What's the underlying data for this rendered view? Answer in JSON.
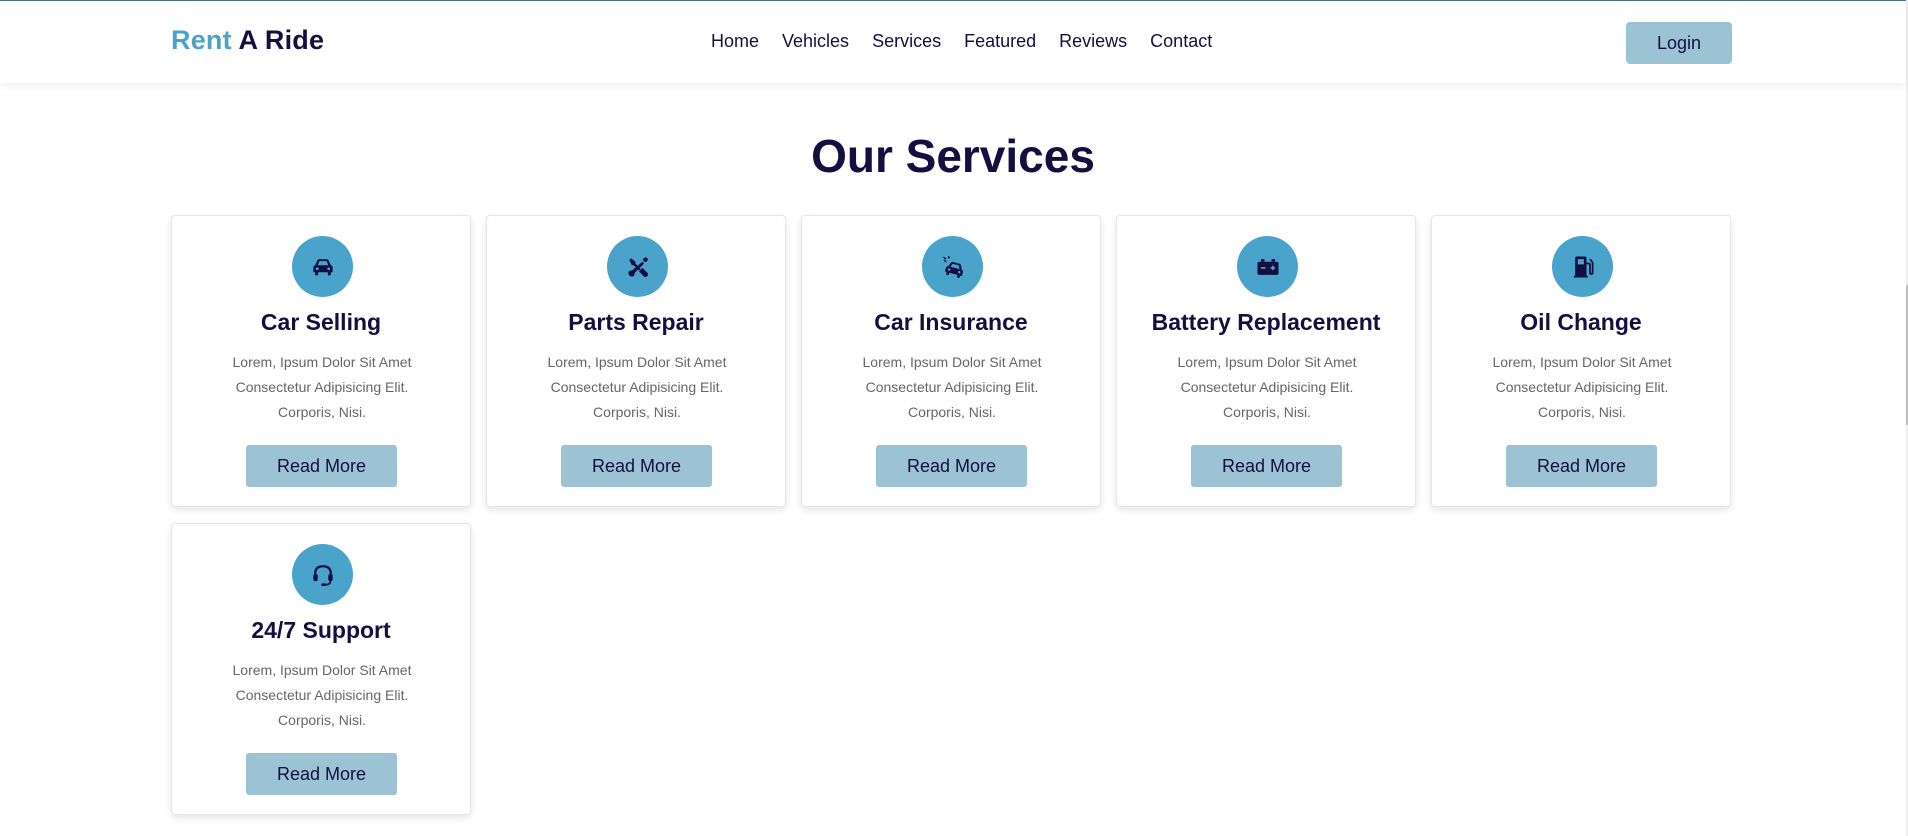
{
  "header": {
    "logo_accent": "Rent",
    "logo_rest": " A Ride",
    "nav": [
      "Home",
      "Vehicles",
      "Services",
      "Featured",
      "Reviews",
      "Contact"
    ],
    "login_label": "Login"
  },
  "section": {
    "title_plain": "Our ",
    "title_underlined": "Services"
  },
  "services": [
    {
      "title": "Car Selling",
      "icon": "car-icon",
      "desc": "Lorem, Ipsum Dolor Sit Amet Consectetur Adipisicing Elit. Corporis, Nisi.",
      "button": "Read More"
    },
    {
      "title": "Parts Repair",
      "icon": "tools-icon",
      "desc": "Lorem, Ipsum Dolor Sit Amet Consectetur Adipisicing Elit. Corporis, Nisi.",
      "button": "Read More"
    },
    {
      "title": "Car Insurance",
      "icon": "car-crash-icon",
      "desc": "Lorem, Ipsum Dolor Sit Amet Consectetur Adipisicing Elit. Corporis, Nisi.",
      "button": "Read More"
    },
    {
      "title": "Battery Replacement",
      "icon": "car-battery-icon",
      "desc": "Lorem, Ipsum Dolor Sit Amet Consectetur Adipisicing Elit. Corporis, Nisi.",
      "button": "Read More"
    },
    {
      "title": "Oil Change",
      "icon": "gas-pump-icon",
      "desc": "Lorem, Ipsum Dolor Sit Amet Consectetur Adipisicing Elit. Corporis, Nisi.",
      "button": "Read More"
    },
    {
      "title": "24/7 Support",
      "icon": "headset-icon",
      "desc": "Lorem, Ipsum Dolor Sit Amet Consectetur Adipisicing Elit. Corporis, Nisi.",
      "button": "Read More"
    }
  ],
  "colors": {
    "accent": "#4aa3cb",
    "button_bg": "#9cc3d3",
    "text_dark": "#130f40",
    "text_muted": "#666666"
  }
}
